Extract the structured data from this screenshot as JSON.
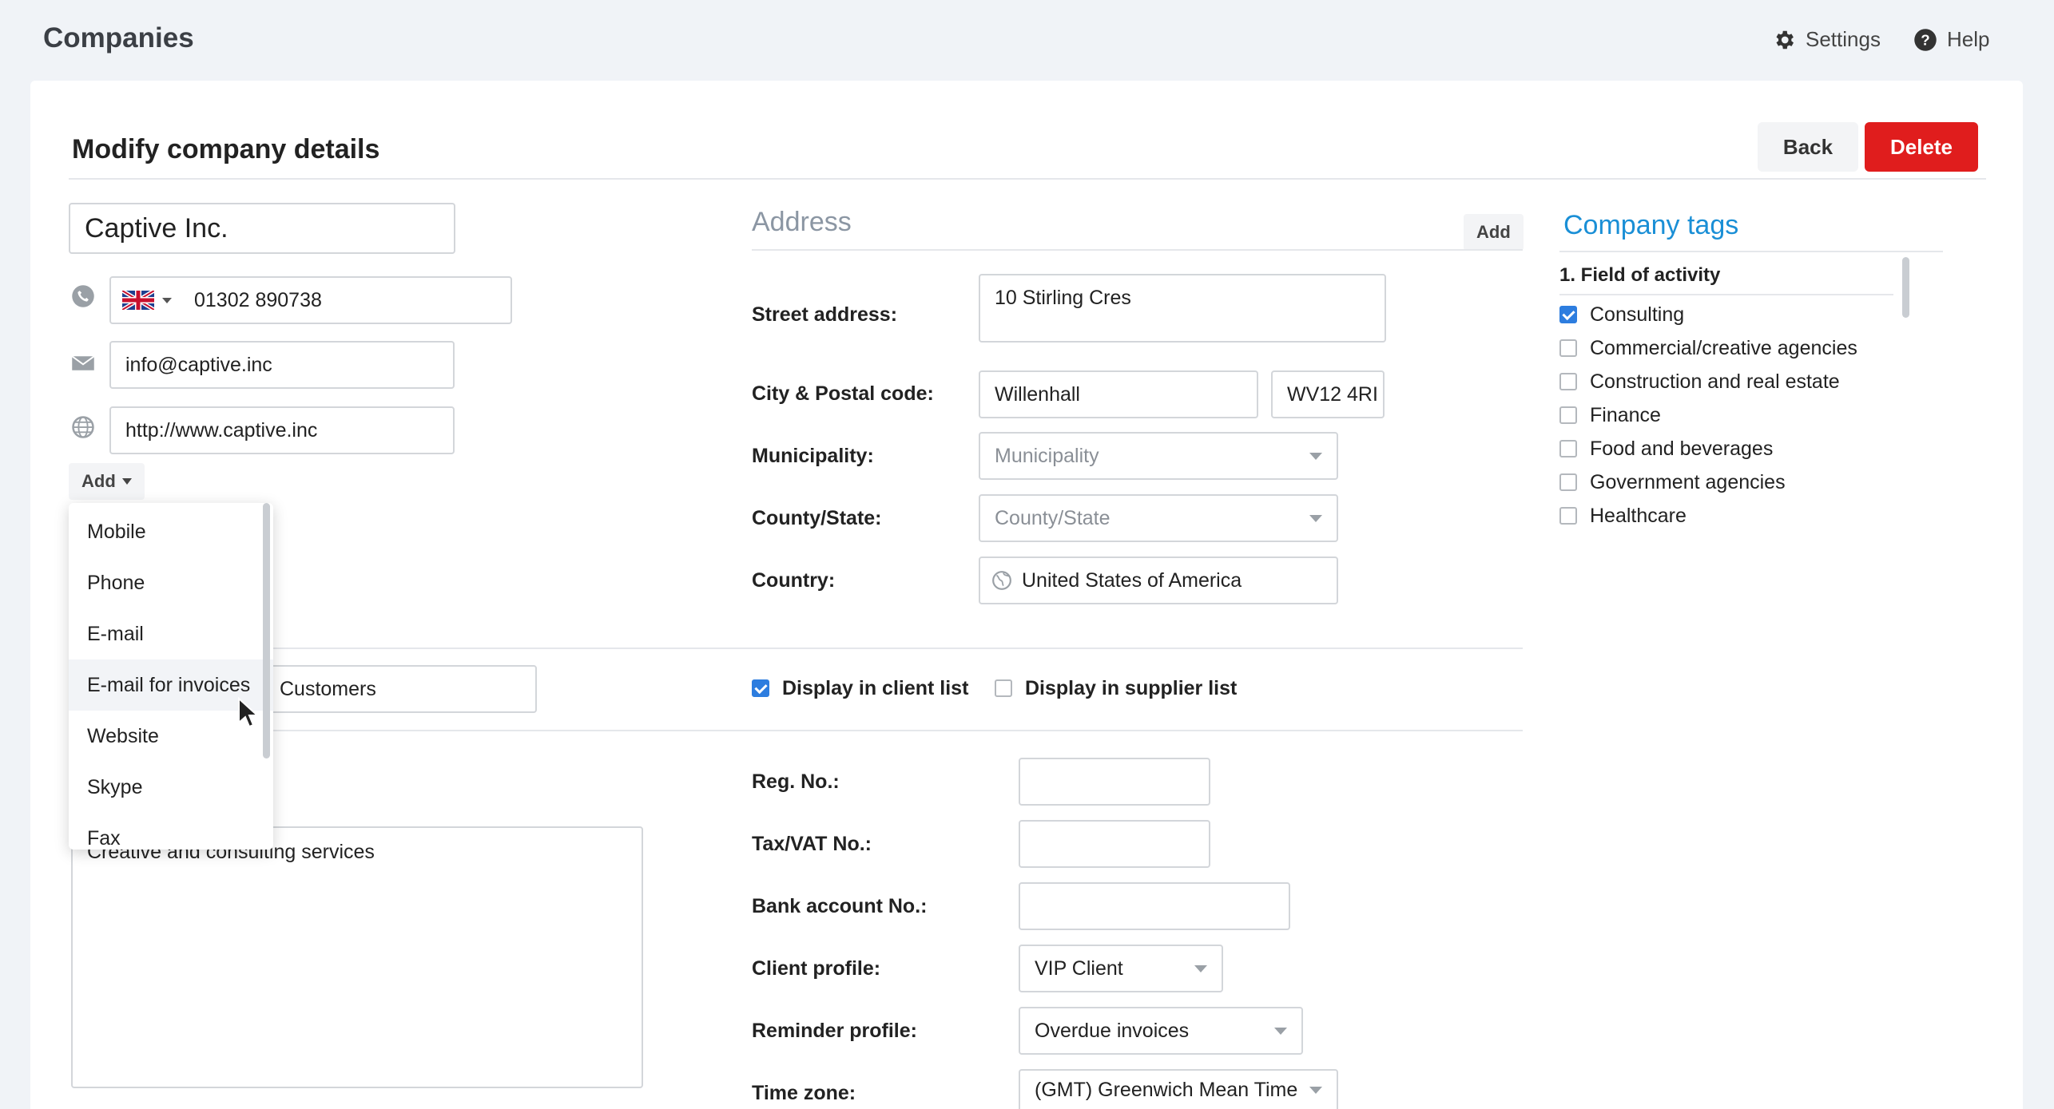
{
  "topbar": {
    "title": "Companies",
    "settings_label": "Settings",
    "help_label": "Help"
  },
  "page": {
    "title": "Modify company details",
    "back_label": "Back",
    "delete_label": "Delete"
  },
  "contact": {
    "company_name": "Captive Inc.",
    "phone": "01302 890738",
    "email": "info@captive.inc",
    "website": "http://www.captive.inc",
    "add_label": "Add",
    "group_value": "Customers",
    "description": "Creative and consulting services"
  },
  "add_menu": {
    "items": [
      "Mobile",
      "Phone",
      "E-mail",
      "E-mail for invoices",
      "Website",
      "Skype",
      "Fax"
    ]
  },
  "address": {
    "heading": "Address",
    "add_label": "Add",
    "street_label": "Street address:",
    "street_value": "10 Stirling Cres",
    "city_label": "City & Postal code:",
    "city_value": "Willenhall",
    "postal_value": "WV12 4RI",
    "municipality_label": "Municipality:",
    "municipality_placeholder": "Municipality",
    "county_label": "County/State:",
    "county_placeholder": "County/State",
    "country_label": "Country:",
    "country_value": "United States of America"
  },
  "lists": {
    "client_label": "Display in client list",
    "client_checked": true,
    "supplier_label": "Display in supplier list",
    "supplier_checked": false
  },
  "details": {
    "reg_label": "Reg. No.:",
    "tax_label": "Tax/VAT No.:",
    "bank_label": "Bank account No.:",
    "client_profile_label": "Client profile:",
    "client_profile_value": "VIP Client",
    "reminder_label": "Reminder profile:",
    "reminder_value": "Overdue invoices",
    "timezone_label": "Time zone:",
    "timezone_value": "(GMT) Greenwich Mean Time"
  },
  "tags": {
    "heading": "Company tags",
    "group_title": "1. Field of activity",
    "items": [
      {
        "label": "Consulting",
        "checked": true
      },
      {
        "label": "Commercial/creative agencies",
        "checked": false
      },
      {
        "label": "Construction and real estate",
        "checked": false
      },
      {
        "label": "Finance",
        "checked": false
      },
      {
        "label": "Food and beverages",
        "checked": false
      },
      {
        "label": "Government agencies",
        "checked": false
      },
      {
        "label": "Healthcare",
        "checked": false
      }
    ]
  },
  "colors": {
    "accent": "#1a8fd6",
    "delete": "#e01d1d",
    "checkbox": "#2d7ddf",
    "background": "#f0f3f7"
  }
}
